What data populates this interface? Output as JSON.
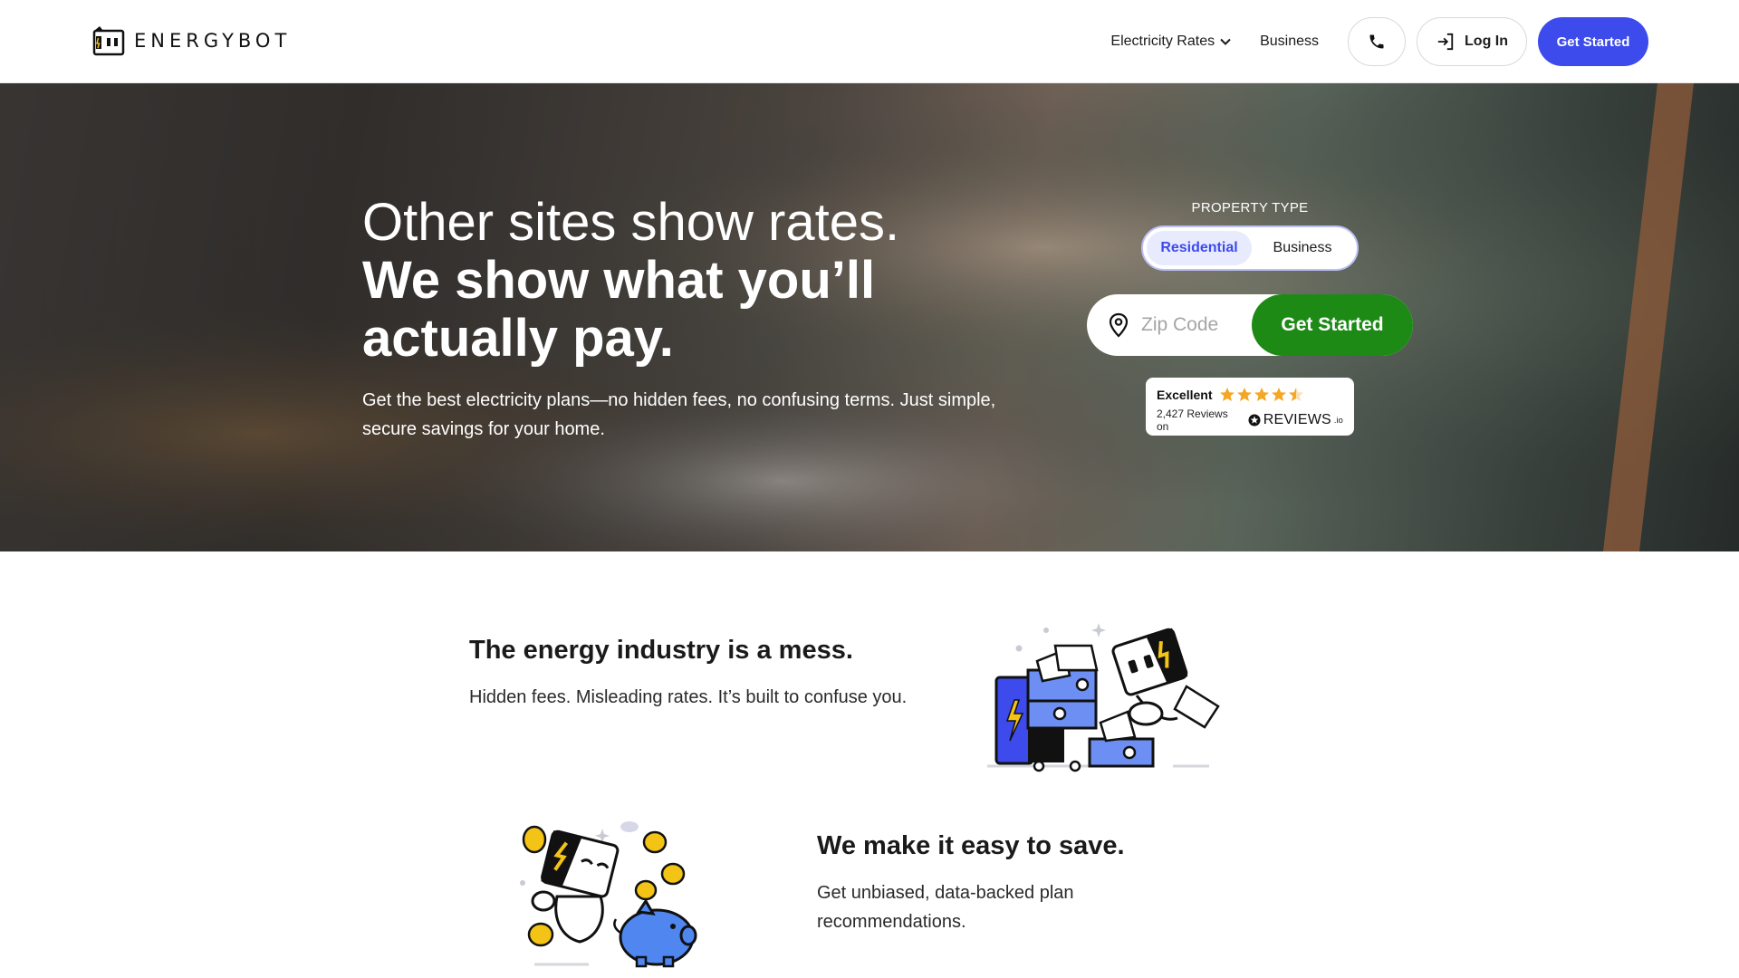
{
  "brand": {
    "logo_text": "ENERGYBOT",
    "accent": "#3d4bec",
    "green": "#1d8a16"
  },
  "nav": {
    "electricity_rates": "Electricity Rates",
    "business": "Business",
    "phone_icon": "phone-icon",
    "login": "Log In",
    "get_started": "Get Started"
  },
  "hero": {
    "title_line1": "Other sites show rates.",
    "title_line2": "We show what you’ll actually pay.",
    "subtitle": "Get the best electricity plans—no hidden fees, no confusing terms. Just simple, secure savings for your home.",
    "property_type_label": "PROPERTY TYPE",
    "property_options": [
      "Residential",
      "Business"
    ],
    "selected_property": "Residential",
    "zip_placeholder": "Zip Code",
    "zip_button": "Get Started"
  },
  "reviews": {
    "rating_text": "Excellent",
    "stars": 4.5,
    "count_text": "2,427 Reviews on",
    "brand": "REVIEWS",
    "brand_suffix": ".io"
  },
  "sections": [
    {
      "title": "The energy industry is a mess.",
      "text": "Hidden fees. Misleading rates. It’s built to confuse you."
    },
    {
      "title": "We make it easy to save.",
      "text": "Get unbiased, data-backed plan recommendations."
    }
  ]
}
